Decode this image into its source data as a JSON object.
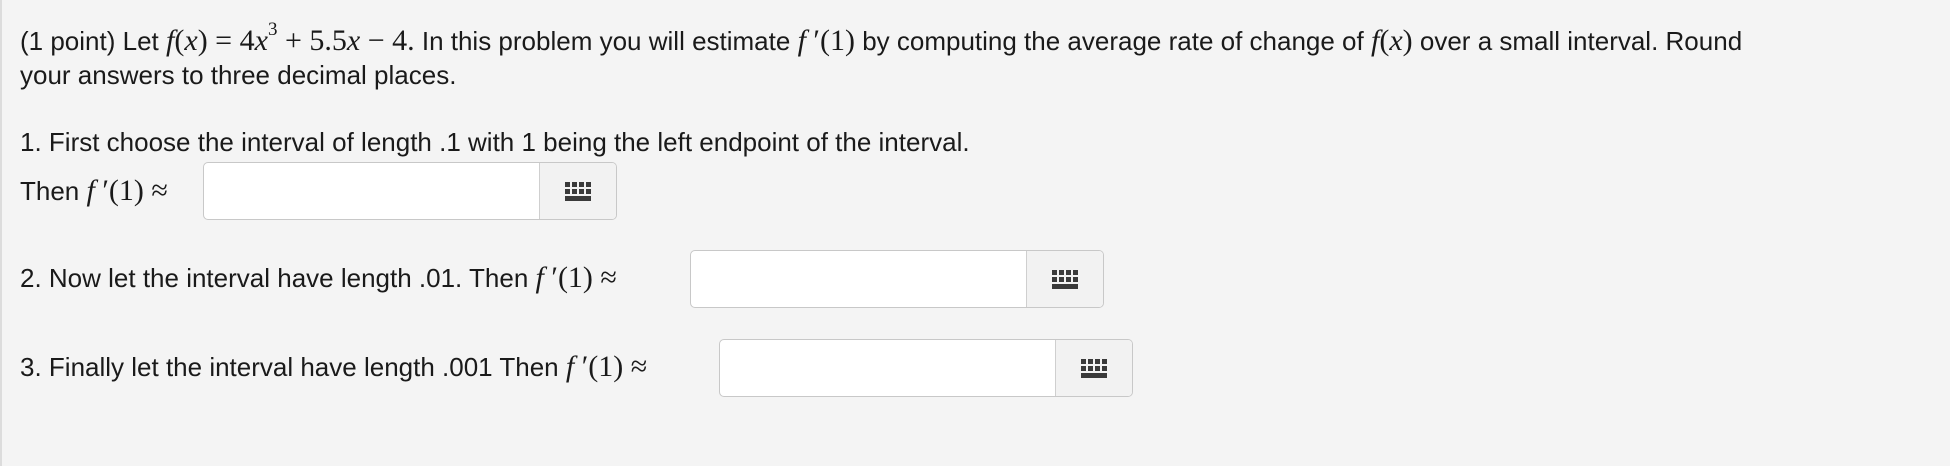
{
  "intro": {
    "points": "(1 point)",
    "let_word": "Let",
    "function_def": "f(x) = 4x³ + 5.5x − 4.",
    "text_a": "In this problem you will estimate",
    "derivative_expr": "f′(1)",
    "text_b": "by computing the average rate of change of",
    "fx_expr": "f(x)",
    "text_c": "over a small interval. Round",
    "line2": "your answers to three decimal places."
  },
  "parts": [
    {
      "prompt_line1": "1. First choose the interval of length .1 with 1 being the left endpoint of the interval.",
      "prompt_before_math": "Then",
      "math": "f′(1) ≈",
      "answer_value": "",
      "keyboard_icon": "keyboard-grid-icon"
    },
    {
      "prompt_before_math": "2. Now let the interval have length .01. Then",
      "math": "f′(1) ≈",
      "answer_value": "",
      "keyboard_icon": "keyboard-grid-icon"
    },
    {
      "prompt_before_math": "3. Finally let the interval have length .001 Then",
      "math": "f′(1) ≈",
      "answer_value": "",
      "keyboard_icon": "keyboard-grid-icon"
    }
  ]
}
